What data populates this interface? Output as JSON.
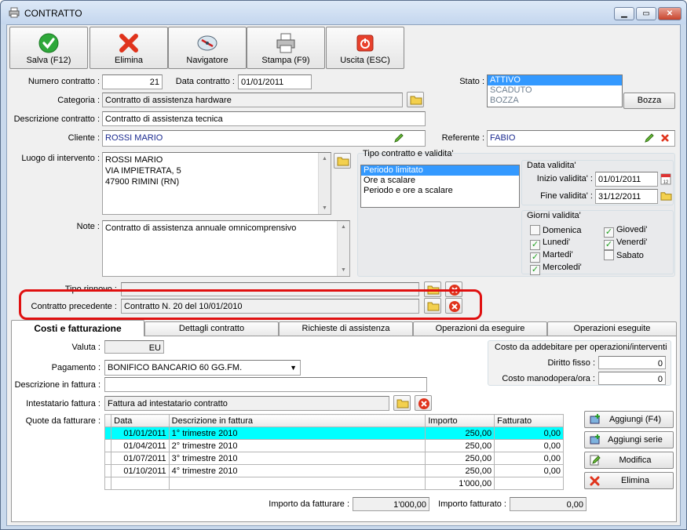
{
  "window": {
    "title": "CONTRATTO"
  },
  "toolbar": {
    "save": "Salva (F12)",
    "delete": "Elimina",
    "navigator": "Navigatore",
    "print": "Stampa (F9)",
    "exit": "Uscita (ESC)"
  },
  "form": {
    "numero_label": "Numero contratto :",
    "numero_value": "21",
    "data_label": "Data contratto :",
    "data_value": "01/01/2011",
    "stato_label": "Stato :",
    "stato_options": [
      "ATTIVO",
      "SCADUTO",
      "BOZZA"
    ],
    "bozza_button": "Bozza",
    "categoria_label": "Categoria :",
    "categoria_value": "Contratto di assistenza hardware",
    "descrizione_label": "Descrizione contratto :",
    "descrizione_value": "Contratto di assistenza tecnica",
    "cliente_label": "Cliente :",
    "cliente_value": "ROSSI MARIO",
    "referente_label": "Referente :",
    "referente_value": "FABIO",
    "luogo_label": "Luogo di intervento :",
    "luogo_lines": [
      "ROSSI MARIO",
      "VIA IMPIETRATA, 5",
      "47900 RIMINI (RN)"
    ],
    "note_label": "Note :",
    "note_value": "Contratto di assistenza annuale omnicomprensivo",
    "tipo_rinnovo_label": "Tipo rinnovo :",
    "tipo_rinnovo_value": "",
    "precedente_label": "Contratto precedente :",
    "precedente_value": "Contratto N. 20 del 10/01/2010"
  },
  "tipo_validita": {
    "title": "Tipo contratto e validita'",
    "options": [
      "Periodo limitato",
      "Ore a scalare",
      "Periodo e ore a scalare"
    ],
    "data_title": "Data validita'",
    "inizio_label": "Inizio validita' :",
    "inizio_value": "01/01/2011",
    "fine_label": "Fine validita' :",
    "fine_value": "31/12/2011",
    "giorni_title": "Giorni validita'",
    "giorni": {
      "domenica": "Domenica",
      "lunedi": "Lunedi'",
      "martedi": "Martedi'",
      "mercoledi": "Mercoledi'",
      "giovedi": "Giovedi'",
      "venerdi": "Venerdi'",
      "sabato": "Sabato"
    },
    "check_mark": "✓"
  },
  "tabs": [
    "Costi e fatturazione",
    "Dettagli contratto",
    "Richieste di assistenza",
    "Operazioni da eseguire",
    "Operazioni eseguite"
  ],
  "costi": {
    "valuta_label": "Valuta :",
    "valuta_value": "EU",
    "pagamento_label": "Pagamento :",
    "pagamento_value": "BONIFICO BANCARIO 60 GG.FM.",
    "descr_fattura_label": "Descrizione in fattura :",
    "descr_fattura_value": "",
    "intestatario_label": "Intestatario fattura :",
    "intestatario_value": "Fattura ad intestatario contratto",
    "quote_label": "Quote da fatturare :",
    "costo_group_title": "Costo da addebitare per operazioni/interventi",
    "diritto_label": "Diritto fisso :",
    "diritto_value": "0",
    "manodopera_label": "Costo manodopera/ora :",
    "manodopera_value": "0",
    "table": {
      "headers": [
        "Data",
        "Descrizione in fattura",
        "Importo",
        "Fatturato"
      ],
      "rows": [
        [
          "01/01/2011",
          "1° trimestre 2010",
          "250,00",
          "0,00"
        ],
        [
          "01/04/2011",
          "2° trimestre 2010",
          "250,00",
          "0,00"
        ],
        [
          "01/07/2011",
          "3° trimestre 2010",
          "250,00",
          "0,00"
        ],
        [
          "01/10/2011",
          "4° trimestre 2010",
          "250,00",
          "0,00"
        ]
      ],
      "total": "1'000,00"
    },
    "buttons": {
      "add": "Aggiungi (F4)",
      "add_series": "Aggiungi serie",
      "edit": "Modifica",
      "delete": "Elimina"
    },
    "importo_da_fatturare_label": "Importo da fatturare :",
    "importo_da_fatturare_value": "1'000,00",
    "importo_fatturato_label": "Importo fatturato :",
    "importo_fatturato_value": "0,00"
  },
  "colors": {
    "accent_selection": "#3399ff",
    "highlight_row": "#00ffff",
    "annotation_frame": "#e01010"
  }
}
